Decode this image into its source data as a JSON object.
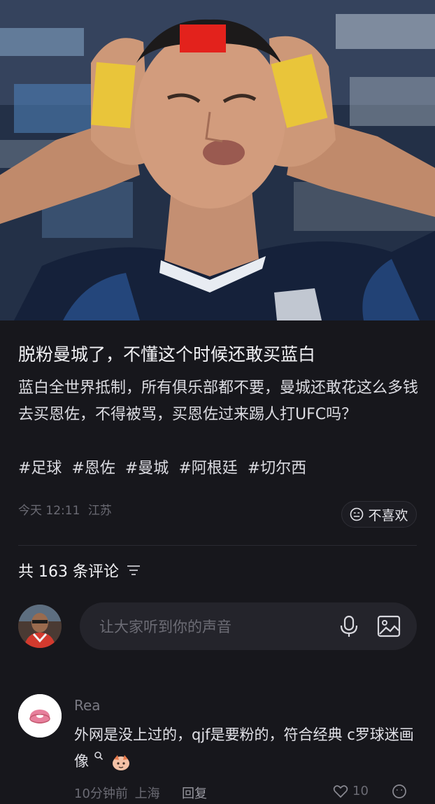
{
  "post": {
    "title": "脱粉曼城了，不懂这个时候还敢买蓝白",
    "body": "蓝白全世界抵制，所有俱乐部都不要，曼城还敢花这么多钱去买恩佐，不得被骂，买恩佐过来踢人打UFC吗？",
    "tags": [
      "#足球",
      "#恩佐",
      "#曼城",
      "#阿根廷",
      "#切尔西"
    ],
    "time": "今天 12:11",
    "location": "江苏",
    "dislike_label": "不喜欢"
  },
  "comments_header": {
    "label": "共 163 条评论"
  },
  "composer": {
    "placeholder": "让大家听到你的声音"
  },
  "comment": {
    "username": "Rea",
    "text": "外网是没上过的，qjf是要粉的，符合经典 c罗球迷画像",
    "time": "10分钟前",
    "location": "上海",
    "reply_label": "回复",
    "likes": "10"
  },
  "colors": {
    "background": "#17171c",
    "red_card": "#e3221c",
    "yellow_card": "#e9c53a"
  }
}
